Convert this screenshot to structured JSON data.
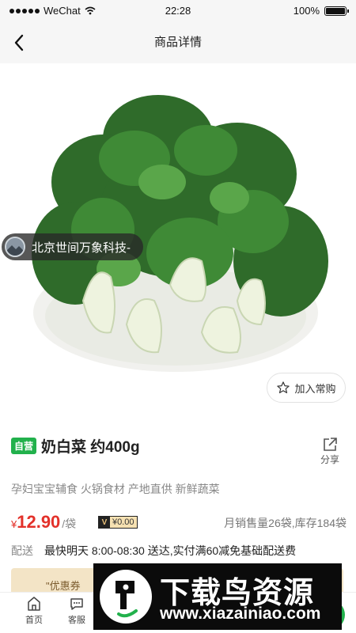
{
  "status_bar": {
    "carrier": "WeChat",
    "time": "22:28",
    "battery": "100%"
  },
  "nav": {
    "title": "商品详情"
  },
  "store": {
    "name": "北京世间万象科技-"
  },
  "favorite": {
    "label": "加入常购"
  },
  "product": {
    "tag": "自营",
    "name": "奶白菜 约400g",
    "subtitle": "孕妇宝宝辅食 火锅食材 产地直供 新鲜蔬菜",
    "price_currency": "¥",
    "price": "12.90",
    "price_unit": "/袋",
    "vip_price": "¥0.00",
    "sales_stock": "月销售量26袋,库存184袋"
  },
  "share": {
    "label": "分享"
  },
  "delivery": {
    "label": "配送",
    "text": "最快明天 8:00-08:30 送达,实付满60减免基础配送费"
  },
  "coupon": {
    "text": "\"优惠券"
  },
  "bottom_nav": {
    "home_label": "首页",
    "service_label": "客服"
  },
  "watermark": {
    "title": "下载鸟资源",
    "url": "www.xiazainiao.com"
  },
  "colors": {
    "accent_green": "#22b14c",
    "price_red": "#e3312a",
    "coupon_bg": "#f3e4c6"
  }
}
